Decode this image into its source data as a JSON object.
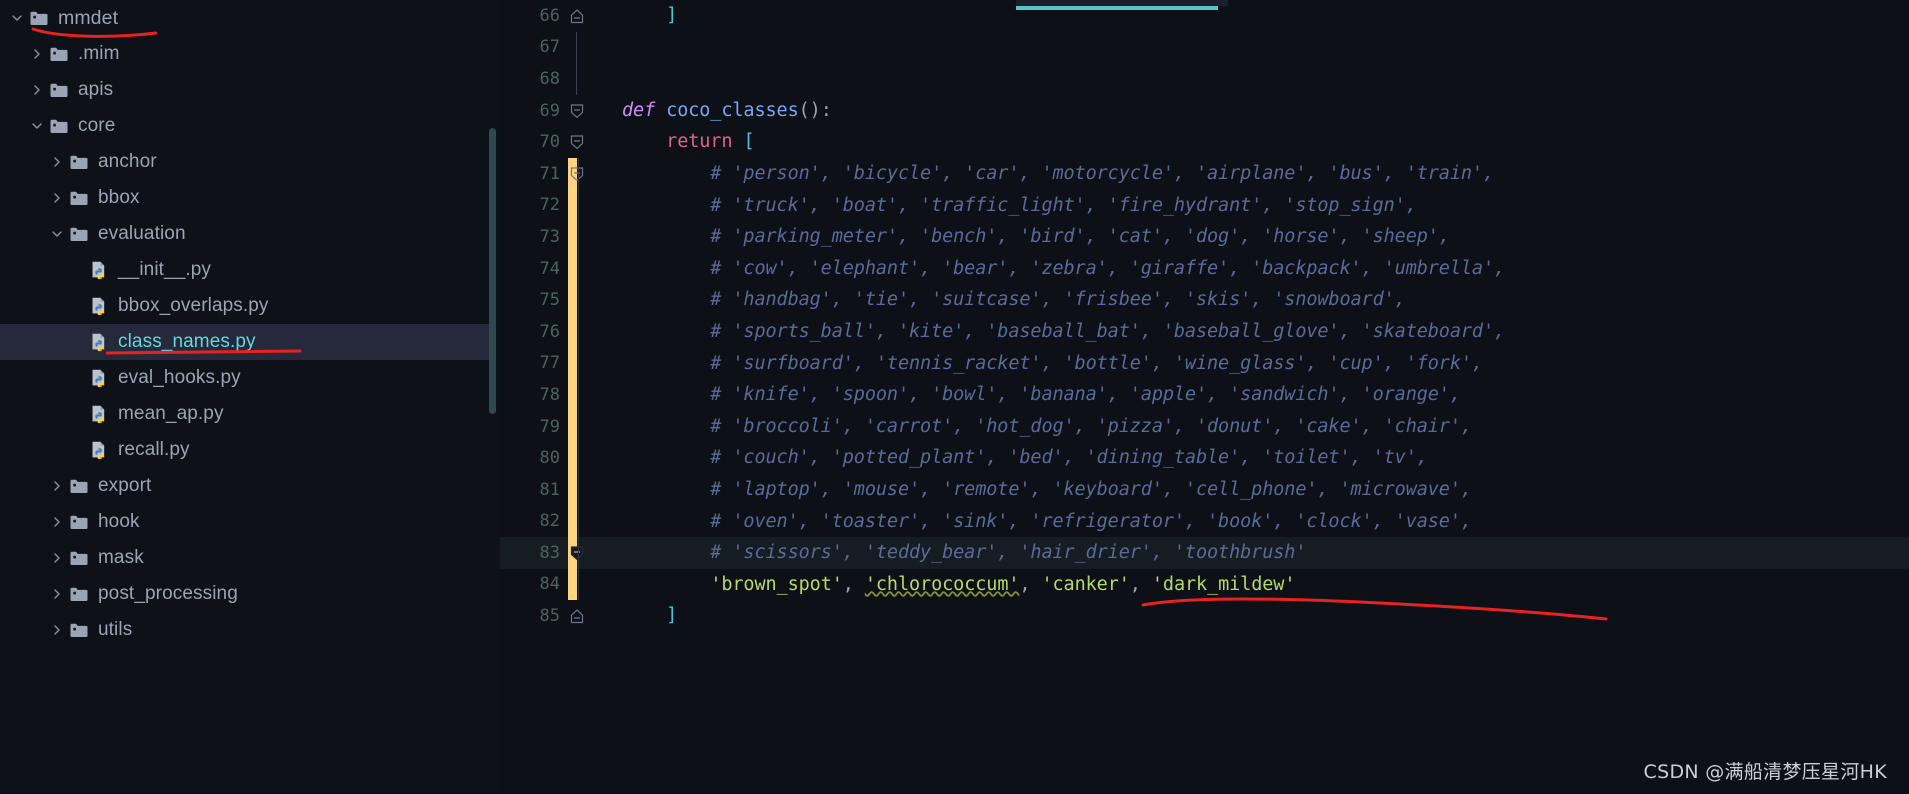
{
  "colors": {
    "editor_bg": "#0d1017",
    "sidebar_bg": "#0e1117",
    "selection_bg": "#26283c",
    "selected_text": "#5fd9dd",
    "current_line_bg": "#151d22",
    "accent_teal": "#56c5cc",
    "change_bar_orange": "#ffd480",
    "annotation_red": "#e8221f",
    "comment": "#5a6b99",
    "string": "#b5d96a",
    "keyword": "#cf8ef4",
    "linenumber": "#4a6361"
  },
  "sidebar": {
    "scrollbar": {
      "visible": true
    },
    "items": [
      {
        "label": "mmdet",
        "type": "folder",
        "depth": 0,
        "expanded": true,
        "selected": false,
        "annotated": true
      },
      {
        "label": ".mim",
        "type": "folder",
        "depth": 1,
        "expanded": false,
        "selected": false,
        "annotated": false
      },
      {
        "label": "apis",
        "type": "folder",
        "depth": 1,
        "expanded": false,
        "selected": false,
        "annotated": false
      },
      {
        "label": "core",
        "type": "folder",
        "depth": 1,
        "expanded": true,
        "selected": false,
        "annotated": false
      },
      {
        "label": "anchor",
        "type": "folder",
        "depth": 2,
        "expanded": false,
        "selected": false,
        "annotated": false
      },
      {
        "label": "bbox",
        "type": "folder",
        "depth": 2,
        "expanded": false,
        "selected": false,
        "annotated": false
      },
      {
        "label": "evaluation",
        "type": "folder",
        "depth": 2,
        "expanded": true,
        "selected": false,
        "annotated": false
      },
      {
        "label": "__init__.py",
        "type": "python",
        "depth": 3,
        "expanded": null,
        "selected": false,
        "annotated": false
      },
      {
        "label": "bbox_overlaps.py",
        "type": "python",
        "depth": 3,
        "expanded": null,
        "selected": false,
        "annotated": false
      },
      {
        "label": "class_names.py",
        "type": "python",
        "depth": 3,
        "expanded": null,
        "selected": true,
        "annotated": true
      },
      {
        "label": "eval_hooks.py",
        "type": "python",
        "depth": 3,
        "expanded": null,
        "selected": false,
        "annotated": false
      },
      {
        "label": "mean_ap.py",
        "type": "python",
        "depth": 3,
        "expanded": null,
        "selected": false,
        "annotated": false
      },
      {
        "label": "recall.py",
        "type": "python",
        "depth": 3,
        "expanded": null,
        "selected": false,
        "annotated": false
      },
      {
        "label": "export",
        "type": "folder",
        "depth": 2,
        "expanded": false,
        "selected": false,
        "annotated": false
      },
      {
        "label": "hook",
        "type": "folder",
        "depth": 2,
        "expanded": false,
        "selected": false,
        "annotated": false
      },
      {
        "label": "mask",
        "type": "folder",
        "depth": 2,
        "expanded": false,
        "selected": false,
        "annotated": false
      },
      {
        "label": "post_processing",
        "type": "folder",
        "depth": 2,
        "expanded": false,
        "selected": false,
        "annotated": false
      },
      {
        "label": "utils",
        "type": "folder",
        "depth": 2,
        "expanded": false,
        "selected": false,
        "annotated": false
      }
    ]
  },
  "editor": {
    "filename": "class_names.py",
    "language": "Python",
    "current_line": 83,
    "lines": [
      {
        "number": 66,
        "fold": "end",
        "changed": false,
        "current": false,
        "indent_guide": false,
        "tokens": [
          {
            "t": "    ",
            "c": "plain"
          },
          {
            "t": "]",
            "c": "brk"
          }
        ]
      },
      {
        "number": 67,
        "fold": "line",
        "changed": false,
        "current": false,
        "indent_guide": false,
        "tokens": []
      },
      {
        "number": 68,
        "fold": "line",
        "changed": false,
        "current": false,
        "indent_guide": false,
        "tokens": []
      },
      {
        "number": 69,
        "fold": "open",
        "changed": false,
        "current": false,
        "indent_guide": false,
        "tokens": [
          {
            "t": "def ",
            "c": "kw"
          },
          {
            "t": "coco_classes",
            "c": "fn"
          },
          {
            "t": "():",
            "c": "punct"
          }
        ]
      },
      {
        "number": 70,
        "fold": "open",
        "changed": false,
        "current": false,
        "indent_guide": false,
        "tokens": [
          {
            "t": "    ",
            "c": "plain"
          },
          {
            "t": "return",
            "c": "kw2"
          },
          {
            "t": " ",
            "c": "plain"
          },
          {
            "t": "[",
            "c": "brk"
          }
        ]
      },
      {
        "number": 71,
        "fold": "open",
        "changed": true,
        "current": false,
        "indent_guide": true,
        "tokens": [
          {
            "t": "        # 'person', 'bicycle', 'car', 'motorcycle', 'airplane', 'bus', 'train',",
            "c": "cmt"
          }
        ]
      },
      {
        "number": 72,
        "fold": null,
        "changed": true,
        "current": false,
        "indent_guide": true,
        "tokens": [
          {
            "t": "        # 'truck', 'boat', 'traffic_light', 'fire_hydrant', 'stop_sign',",
            "c": "cmt"
          }
        ]
      },
      {
        "number": 73,
        "fold": null,
        "changed": true,
        "current": false,
        "indent_guide": true,
        "tokens": [
          {
            "t": "        # 'parking_meter', 'bench', 'bird', 'cat', 'dog', 'horse', 'sheep',",
            "c": "cmt"
          }
        ]
      },
      {
        "number": 74,
        "fold": null,
        "changed": true,
        "current": false,
        "indent_guide": true,
        "tokens": [
          {
            "t": "        # 'cow', 'elephant', 'bear', 'zebra', 'giraffe', 'backpack', 'umbrella',",
            "c": "cmt"
          }
        ]
      },
      {
        "number": 75,
        "fold": null,
        "changed": true,
        "current": false,
        "indent_guide": true,
        "tokens": [
          {
            "t": "        # 'handbag', 'tie', 'suitcase', 'frisbee', 'skis', 'snowboard',",
            "c": "cmt"
          }
        ]
      },
      {
        "number": 76,
        "fold": null,
        "changed": true,
        "current": false,
        "indent_guide": true,
        "tokens": [
          {
            "t": "        # 'sports_ball', 'kite', 'baseball_bat', 'baseball_glove', 'skateboard',",
            "c": "cmt"
          }
        ]
      },
      {
        "number": 77,
        "fold": null,
        "changed": true,
        "current": false,
        "indent_guide": true,
        "tokens": [
          {
            "t": "        # 'surfboard', 'tennis_racket', 'bottle', 'wine_glass', 'cup', 'fork',",
            "c": "cmt"
          }
        ]
      },
      {
        "number": 78,
        "fold": null,
        "changed": true,
        "current": false,
        "indent_guide": true,
        "tokens": [
          {
            "t": "        # 'knife', 'spoon', 'bowl', 'banana', 'apple', 'sandwich', 'orange',",
            "c": "cmt"
          }
        ]
      },
      {
        "number": 79,
        "fold": null,
        "changed": true,
        "current": false,
        "indent_guide": true,
        "tokens": [
          {
            "t": "        # 'broccoli', 'carrot', 'hot_dog', 'pizza', 'donut', 'cake', 'chair',",
            "c": "cmt"
          }
        ]
      },
      {
        "number": 80,
        "fold": null,
        "changed": true,
        "current": false,
        "indent_guide": true,
        "tokens": [
          {
            "t": "        # 'couch', 'potted_plant', 'bed', 'dining_table', 'toilet', 'tv',",
            "c": "cmt"
          }
        ]
      },
      {
        "number": 81,
        "fold": null,
        "changed": true,
        "current": false,
        "indent_guide": true,
        "tokens": [
          {
            "t": "        # 'laptop', 'mouse', 'remote', 'keyboard', 'cell_phone', 'microwave',",
            "c": "cmt"
          }
        ]
      },
      {
        "number": 82,
        "fold": null,
        "changed": true,
        "current": false,
        "indent_guide": true,
        "tokens": [
          {
            "t": "        # 'oven', 'toaster', 'sink', 'refrigerator', 'book', 'clock', 'vase',",
            "c": "cmt"
          }
        ]
      },
      {
        "number": 83,
        "fold": "marker",
        "changed": true,
        "current": true,
        "indent_guide": true,
        "tokens": [
          {
            "t": "        # 'scissors', 'teddy_bear', 'hair_drier', 'toothbrush'",
            "c": "cmt"
          }
        ]
      },
      {
        "number": 84,
        "fold": null,
        "changed": true,
        "current": false,
        "indent_guide": true,
        "annotated": true,
        "tokens": [
          {
            "t": "        ",
            "c": "plain"
          },
          {
            "t": "'brown_spot'",
            "c": "str"
          },
          {
            "t": ", ",
            "c": "punct"
          },
          {
            "t": "'chlorococcum'",
            "c": "str-typo"
          },
          {
            "t": ", ",
            "c": "punct"
          },
          {
            "t": "'canker'",
            "c": "str"
          },
          {
            "t": ", ",
            "c": "punct"
          },
          {
            "t": "'dark_mildew'",
            "c": "str"
          }
        ]
      },
      {
        "number": 85,
        "fold": "end",
        "changed": false,
        "current": false,
        "indent_guide": false,
        "tokens": [
          {
            "t": "    ",
            "c": "plain"
          },
          {
            "t": "]",
            "c": "brk"
          }
        ]
      }
    ]
  },
  "watermark": {
    "text": "CSDN @满船清梦压星河HK"
  }
}
